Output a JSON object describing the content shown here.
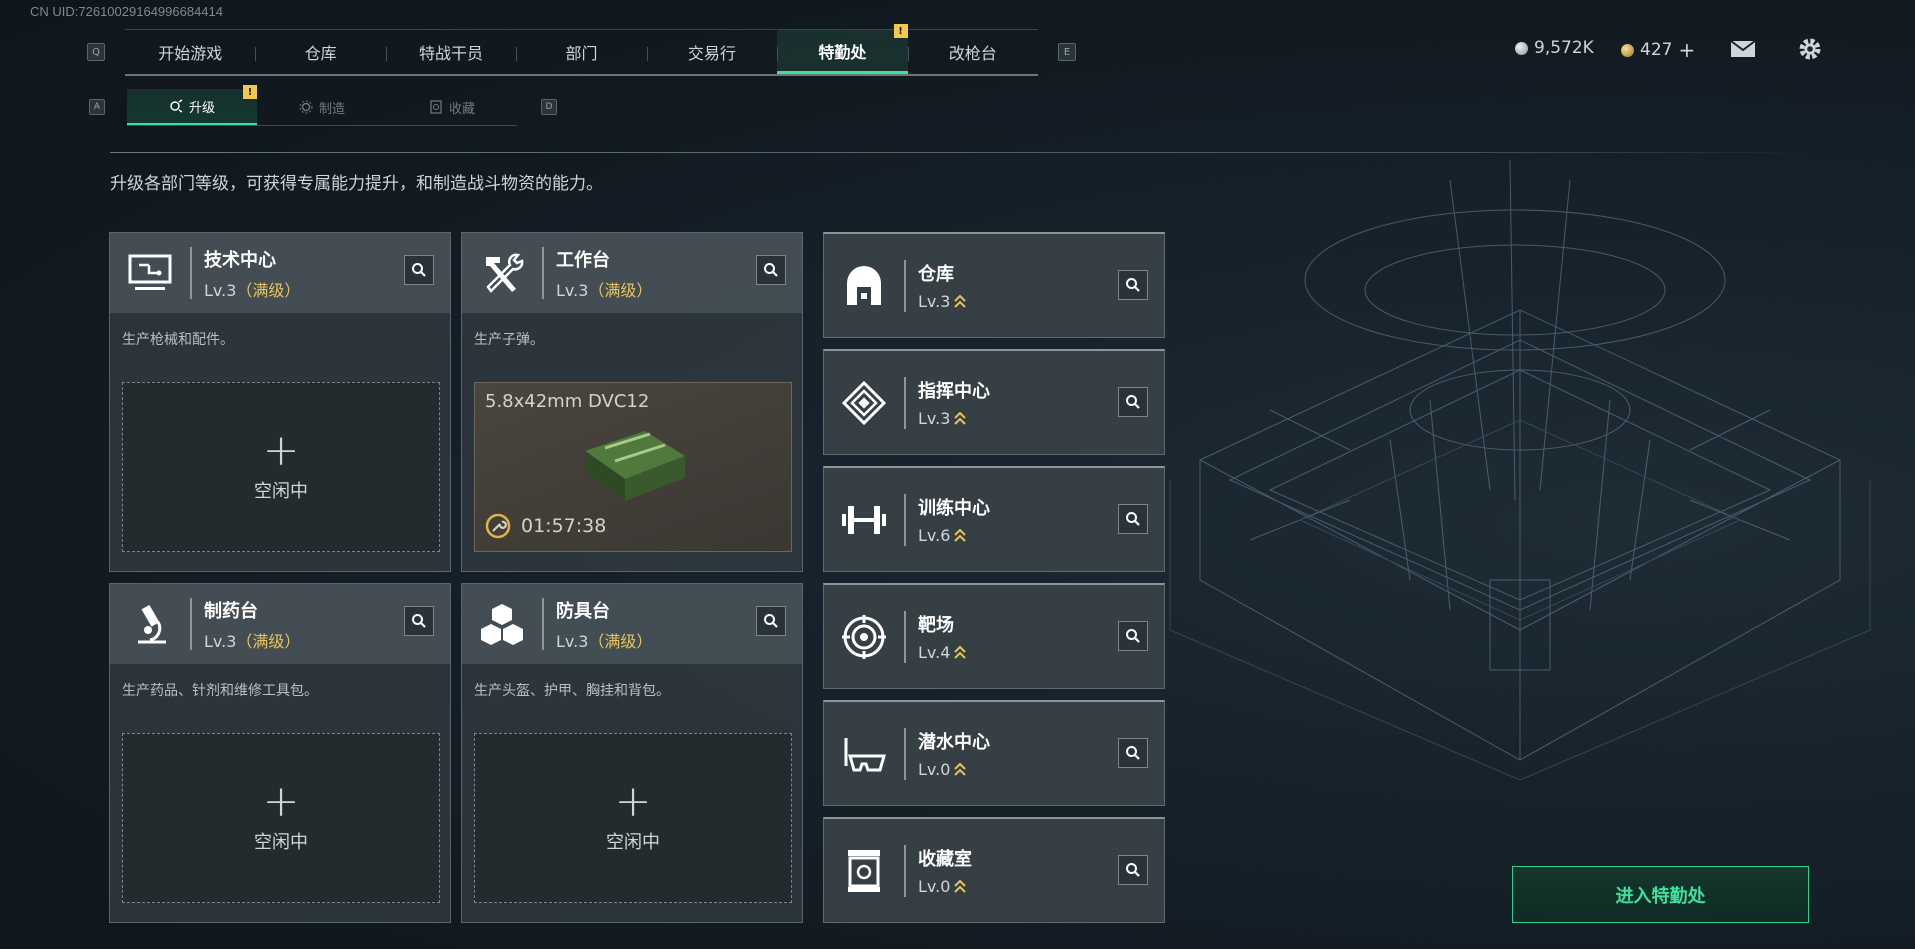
{
  "uid": "CN UID:7261002916499​6684414",
  "top_nav": {
    "left_key": "Q",
    "right_key": "E",
    "tabs": [
      {
        "label": "开始游戏"
      },
      {
        "label": "仓库"
      },
      {
        "label": "特战干员"
      },
      {
        "label": "部门"
      },
      {
        "label": "交易行"
      },
      {
        "label": "特勤处",
        "active": true,
        "badge": "!"
      },
      {
        "label": "改枪台"
      }
    ]
  },
  "sub_nav": {
    "left_key": "A",
    "right_key": "D",
    "tabs": [
      {
        "label": "升级",
        "active": true,
        "badge": "!"
      },
      {
        "label": "制造"
      },
      {
        "label": "收藏"
      }
    ]
  },
  "currency": {
    "silver": "9,572K",
    "gold": "427",
    "gold_add": "+",
    "colors": {
      "silver": "#c9cdd0",
      "gold": "#d8b35a"
    }
  },
  "description": "升级各部门等级，可获得专属能力提升，和制造战斗物资的能力。",
  "workstations": [
    {
      "icon": "monitor-icon",
      "name": "技术中心",
      "level": "Lv.3",
      "max": "（满级）",
      "desc": "生产枪械和配件。",
      "slot": {
        "state": "idle",
        "plus": "+",
        "label": "空闲中"
      }
    },
    {
      "icon": "hammer-wrench-icon",
      "name": "工作台",
      "level": "Lv.3",
      "max": "（满级）",
      "desc": "生产子弹。",
      "slot": {
        "state": "producing",
        "item": "5.8x42mm DVC12",
        "timer": "01:57:38"
      }
    },
    {
      "icon": "microscope-icon",
      "name": "制药台",
      "level": "Lv.3",
      "max": "（满级）",
      "desc": "生产药品、针剂和维修工具包。",
      "slot": {
        "state": "idle",
        "plus": "+",
        "label": "空闲中"
      }
    },
    {
      "icon": "cubes-icon",
      "name": "防具台",
      "level": "Lv.3",
      "max": "（满级）",
      "desc": "生产头盔、护甲、胸挂和背包。",
      "slot": {
        "state": "idle",
        "plus": "+",
        "label": "空闲中"
      }
    }
  ],
  "departments": [
    {
      "icon": "vault-icon",
      "name": "仓库",
      "level": "Lv.3"
    },
    {
      "icon": "command-emblem-icon",
      "name": "指挥中心",
      "level": "Lv.3"
    },
    {
      "icon": "dumbbell-icon",
      "name": "训练中心",
      "level": "Lv.6"
    },
    {
      "icon": "target-icon",
      "name": "靶场",
      "level": "Lv.4"
    },
    {
      "icon": "diving-mask-icon",
      "name": "潜水中心",
      "level": "Lv.0"
    },
    {
      "icon": "collection-case-icon",
      "name": "收藏室",
      "level": "Lv.0"
    }
  ],
  "enter_button": "进入特勤处",
  "accent_color": "#3ee0a0",
  "max_color": "#e8c45a"
}
